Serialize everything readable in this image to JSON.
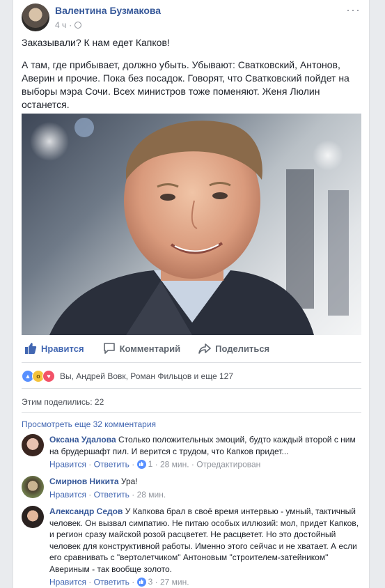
{
  "post": {
    "author": "Валентина Бузмакова",
    "time": "4 ч",
    "more_label": "···",
    "paragraphs": [
      "Заказывали? К нам едет Капков!",
      "А там, где прибывает, должно убыть. Убывают: Сватковский, Антонов, Аверин и прочие. Пока без посадок. Говорят, что Сватковский пойдет на выборы мэра Сочи. Всех министров тоже поменяют. Женя Люлин останется."
    ],
    "photo_icon": "portrait-photo"
  },
  "actions": {
    "like": "Нравится",
    "comment": "Комментарий",
    "share": "Поделиться"
  },
  "reactions": {
    "icons": [
      "like-icon",
      "wow-icon",
      "love-icon"
    ],
    "text": "Вы, Андрей Вовк, Роман Фильцов и еще 127"
  },
  "shares_text": "Этим поделились: 22",
  "view_more": "Просмотреть еще 32 комментария",
  "comments": [
    {
      "name": "Оксана Удалова",
      "text": "Столько положительных эмоций, будто каждый второй с ним на брудершафт пил. И верится с трудом, что Капков придет...",
      "like": "Нравится",
      "reply": "Ответить",
      "likes": "1",
      "time": "28 мин.",
      "edited": "Отредактирован"
    },
    {
      "name": "Смирнов Никита",
      "text": "Ура!",
      "like": "Нравится",
      "reply": "Ответить",
      "time": "28 мин."
    },
    {
      "name": "Александр Седов",
      "text": "У Капкова брал в своё время интервью - умный, тактичный человек. Он вызвал симпатию. Не питаю особых иллюзий: мол, придет Капков, и регион сразу майской розой расцветет. Не расцветет. Но это достойный человек для конструктивной работы. Именно этого сейчас и не хватает. А если его сравнивать с \"вертолетчиком\" Антоновым \"строителем-затейником\" Авериным - так вообще золото.",
      "like": "Нравится",
      "reply": "Ответить",
      "likes": "3",
      "time": "27 мин."
    }
  ],
  "colors": {
    "link": "#365899",
    "action_blue": "#4267b2",
    "muted": "#90949c",
    "background": "#e9ebee"
  }
}
